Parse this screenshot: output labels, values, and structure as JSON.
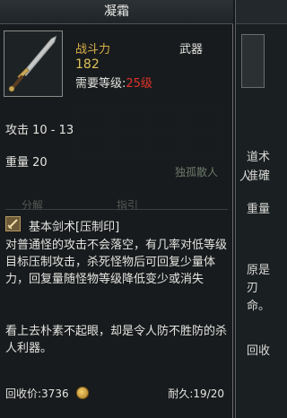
{
  "item": {
    "title": "凝霜",
    "combat_power_label": "战斗力",
    "combat_power_value": "182",
    "level_req_label": "需要等级:",
    "level_req_value": "25级",
    "category": "武器",
    "attack": "攻击 10 - 13",
    "weight": "重量 20"
  },
  "skill": {
    "name": "基本剑术[压制印]",
    "description": "对普通怪的攻击不会落空，有几率对低等级目标压制攻击，杀死怪物后可回复少量体力，回复量随怪物等级降低变少或消失"
  },
  "flavor_text": "看上去朴素不起眼，却是令人防不胜防的杀人利器。",
  "footer": {
    "sell_price": "回收价:3736",
    "durability": "耐久:19/20"
  },
  "background": {
    "player_name": "独孤散人",
    "split_label": "分解",
    "guide_label": "指引"
  },
  "side_panel": {
    "lines": [
      "人",
      "道术",
      "准確",
      "重量",
      "原是",
      "刃",
      "命。",
      "回收"
    ]
  },
  "icons": {
    "item": "sword-icon",
    "skill": "skill-scroll-icon",
    "currency": "gold-coin-icon"
  },
  "colors": {
    "power_label": "#d9b04a",
    "power_value": "#dcc25a",
    "level_requirement": "#e0332b"
  }
}
